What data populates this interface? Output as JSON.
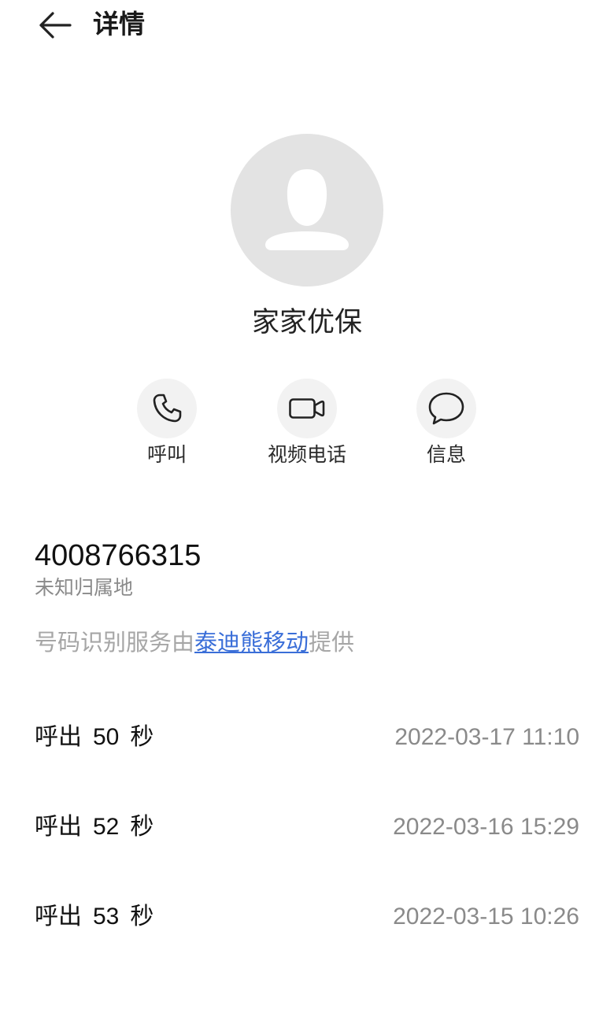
{
  "colors": {
    "background": "#ffffff",
    "text_primary": "#1a1a1a",
    "text_secondary": "#8a8a8a",
    "text_hint": "#a6a6a6",
    "link": "#3a6ed8",
    "avatar_bg": "#e3e3e3",
    "action_bg": "#f2f2f2"
  },
  "header": {
    "back_icon": "back-arrow-icon",
    "title": "详情"
  },
  "contact": {
    "avatar_icon": "person-silhouette-icon",
    "name": "家家优保"
  },
  "actions": [
    {
      "icon": "phone-icon",
      "label": "呼叫"
    },
    {
      "icon": "video-camera-icon",
      "label": "视频电话"
    },
    {
      "icon": "message-bubble-icon",
      "label": "信息"
    }
  ],
  "number": {
    "value": "4008766315",
    "location": "未知归属地"
  },
  "attribution": {
    "prefix": "号码识别服务由",
    "provider": "泰迪熊移动",
    "suffix": "提供"
  },
  "call_log": [
    {
      "direction": "呼出",
      "duration": "50",
      "unit": "秒",
      "datetime": "2022-03-17 11:10"
    },
    {
      "direction": "呼出",
      "duration": "52",
      "unit": "秒",
      "datetime": "2022-03-16 15:29"
    },
    {
      "direction": "呼出",
      "duration": "53",
      "unit": "秒",
      "datetime": "2022-03-15 10:26"
    }
  ]
}
